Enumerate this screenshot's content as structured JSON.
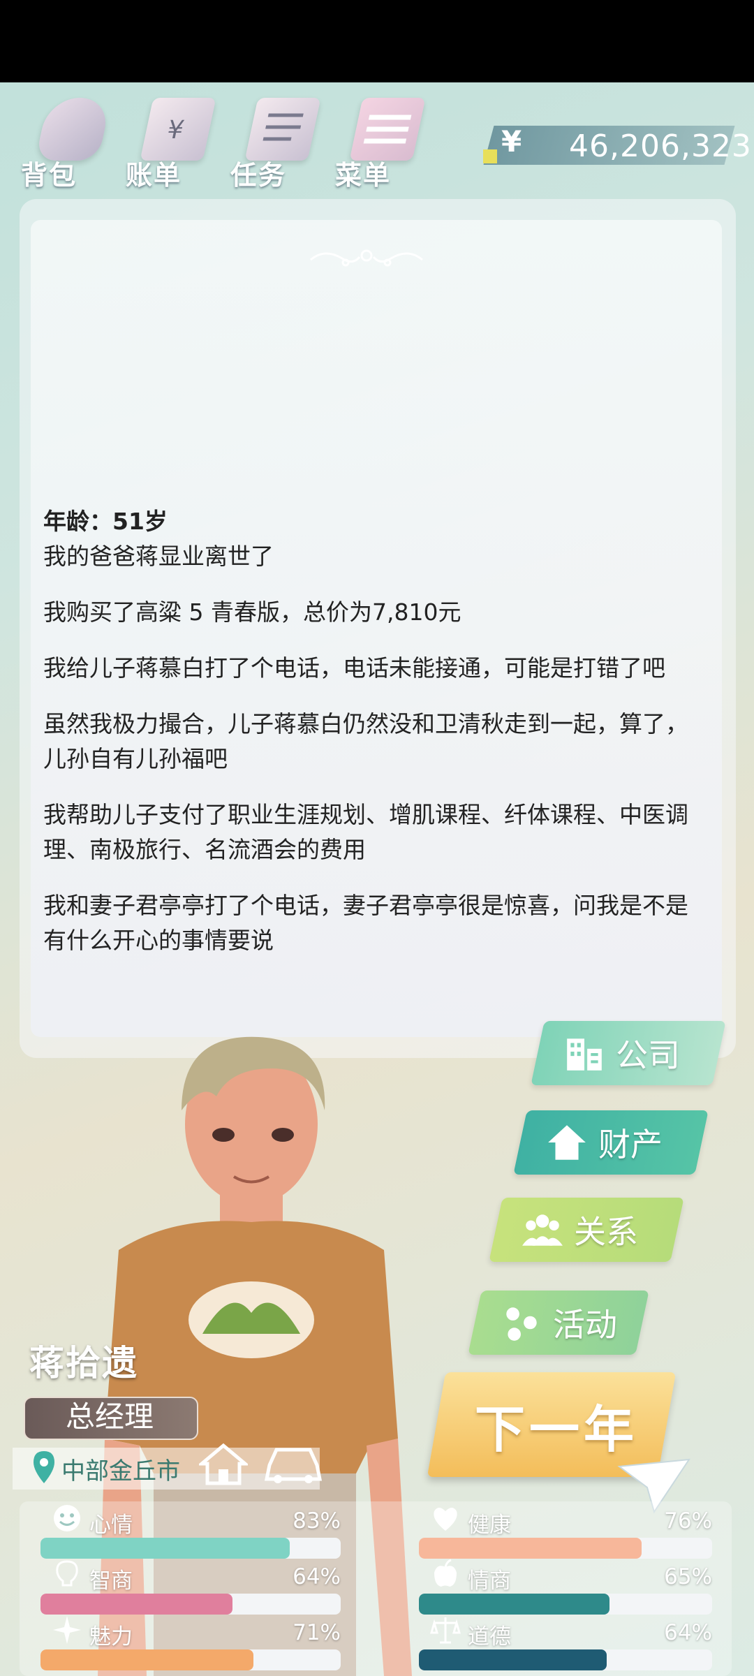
{
  "top_menu": {
    "bag": "背包",
    "bills": "账单",
    "tasks": "任务",
    "menu": "菜单"
  },
  "money": {
    "currency_symbol": "¥",
    "amount": "46,206,323"
  },
  "story": {
    "age_line": "年龄：51岁",
    "events": [
      "我的爸爸蒋显业离世了",
      "我购买了高粱 5 青春版，总价为7,810元",
      "我给儿子蒋慕白打了个电话，电话未能接通，可能是打错了吧",
      "虽然我极力撮合，儿子蒋慕白仍然没和卫清秋走到一起，算了，儿孙自有儿孙福吧",
      "我帮助儿子支付了职业生涯规划、增肌课程、纤体课程、中医调理、南极旅行、名流酒会的费用",
      "我和妻子君亭亭打了个电话，妻子君亭亭很是惊喜，问我是不是有什么开心的事情要说"
    ]
  },
  "actions": {
    "company": "公司",
    "property": "财产",
    "relations": "关系",
    "activities": "活动",
    "next_year": "下一年"
  },
  "profile": {
    "name": "蒋拾遗",
    "title": "总经理",
    "location": "中部金丘市"
  },
  "stats": [
    {
      "label": "心情",
      "value": "83%",
      "fill": 0.83,
      "color": "#7fd3c4",
      "icon": "smile-icon"
    },
    {
      "label": "健康",
      "value": "76%",
      "fill": 0.76,
      "color": "#f7b79a",
      "icon": "heart-icon"
    },
    {
      "label": "智商",
      "value": "64%",
      "fill": 0.64,
      "color": "#e07f9d",
      "icon": "lightbulb-icon"
    },
    {
      "label": "情商",
      "value": "65%",
      "fill": 0.65,
      "color": "#2e8a8a",
      "icon": "apple-icon"
    },
    {
      "label": "魅力",
      "value": "71%",
      "fill": 0.71,
      "color": "#f4a96a",
      "icon": "sparkle-icon"
    },
    {
      "label": "道德",
      "value": "64%",
      "fill": 0.64,
      "color": "#1f5b73",
      "icon": "scale-icon"
    }
  ],
  "colors": {
    "accent_teal": "#3fb1a3",
    "accent_gold": "#f3bd5a"
  }
}
